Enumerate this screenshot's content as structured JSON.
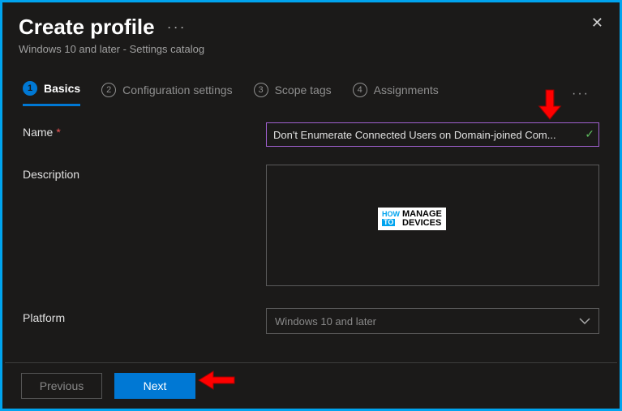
{
  "header": {
    "title": "Create profile",
    "subtitle": "Windows 10 and later - Settings catalog"
  },
  "tabs": [
    {
      "num": "1",
      "label": "Basics",
      "active": true
    },
    {
      "num": "2",
      "label": "Configuration settings",
      "active": false
    },
    {
      "num": "3",
      "label": "Scope tags",
      "active": false
    },
    {
      "num": "4",
      "label": "Assignments",
      "active": false
    }
  ],
  "form": {
    "name_label": "Name",
    "name_value": "Don't Enumerate Connected Users on Domain-joined Com...",
    "desc_label": "Description",
    "desc_value": "",
    "platform_label": "Platform",
    "platform_value": "Windows 10 and later"
  },
  "footer": {
    "prev": "Previous",
    "next": "Next"
  },
  "watermark": {
    "how": "HOW",
    "to": "TO",
    "line1": "MANAGE",
    "line2": "DEVICES"
  }
}
